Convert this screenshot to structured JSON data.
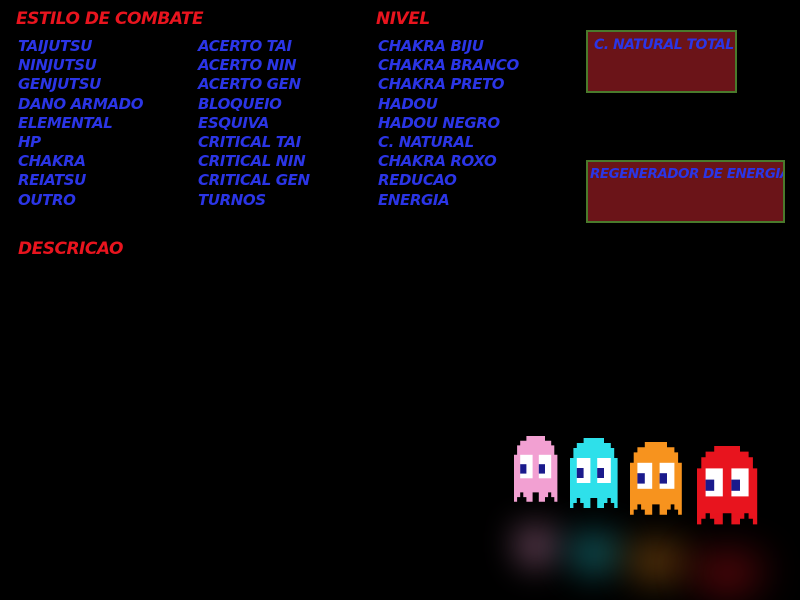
{
  "headings": {
    "combat_style": "ESTILO DE COMBATE",
    "level": "NIVEL",
    "description": "DESCRICAO"
  },
  "columns": {
    "col1": [
      "TAIJUTSU",
      "NINJUTSU",
      "GENJUTSU",
      "DANO ARMADO",
      "ELEMENTAL",
      "HP",
      "CHAKRA",
      "REIATSU",
      "OUTRO"
    ],
    "col2": [
      "ACERTO TAI",
      "ACERTO NIN",
      "ACERTO GEN",
      "BLOQUEIO",
      "ESQUIVA",
      "CRITICAL TAI",
      "CRITICAL NIN",
      "CRITICAL GEN",
      "TURNOS"
    ],
    "col3": [
      "CHAKRA BIJU",
      "CHAKRA BRANCO",
      "CHAKRA PRETO",
      "HADOU",
      "HADOU NEGRO",
      "C. NATURAL",
      "CHAKRA ROXO",
      "REDUCAO",
      "ENERGIA"
    ]
  },
  "boxes": {
    "natural_total": "C. NATURAL TOTAL",
    "energy_regen": "REGENERADOR DE ENERGIA"
  },
  "colors": {
    "heading": "#e8141e",
    "item": "#2b35e6",
    "box_fill": "#6b1418",
    "box_border": "#4a7a2c",
    "ghost_pink": "#f2a0d2",
    "ghost_cyan": "#2ee0ea",
    "ghost_orange": "#f7931e",
    "ghost_red": "#e8141e"
  },
  "icons": {
    "ghost_1": "pink-ghost-icon",
    "ghost_2": "cyan-ghost-icon",
    "ghost_3": "orange-ghost-icon",
    "ghost_4": "red-ghost-icon"
  }
}
